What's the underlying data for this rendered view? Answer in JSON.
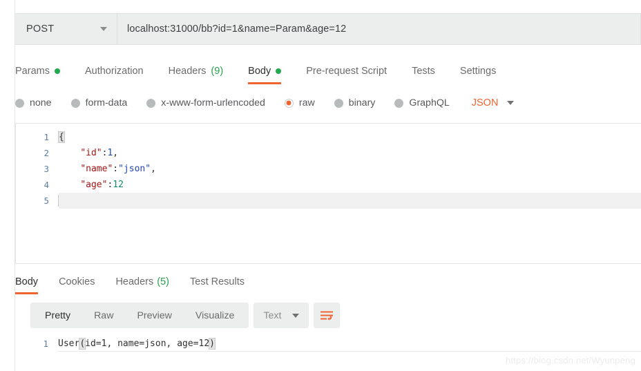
{
  "request": {
    "method": "POST",
    "url": "localhost:31000/bb?id=1&name=Param&age=12",
    "tabs": [
      {
        "label": "Params",
        "indicator": "dot",
        "active": false
      },
      {
        "label": "Authorization",
        "indicator": "none",
        "active": false
      },
      {
        "label": "Headers",
        "indicator": "count",
        "count": "(9)",
        "active": false
      },
      {
        "label": "Body",
        "indicator": "dot",
        "active": true
      },
      {
        "label": "Pre-request Script",
        "indicator": "none",
        "active": false
      },
      {
        "label": "Tests",
        "indicator": "none",
        "active": false
      },
      {
        "label": "Settings",
        "indicator": "none",
        "active": false
      }
    ],
    "body_types": [
      {
        "label": "none",
        "selected": false
      },
      {
        "label": "form-data",
        "selected": false
      },
      {
        "label": "x-www-form-urlencoded",
        "selected": false
      },
      {
        "label": "raw",
        "selected": true
      },
      {
        "label": "binary",
        "selected": false
      },
      {
        "label": "GraphQL",
        "selected": false
      }
    ],
    "raw_format": "JSON",
    "editor_lines": [
      {
        "no": "1",
        "text": "{"
      },
      {
        "no": "2",
        "text": "    \"id\":1,"
      },
      {
        "no": "3",
        "text": "    \"name\":\"json\","
      },
      {
        "no": "4",
        "text": "    \"age\":12"
      },
      {
        "no": "5",
        "text": "}"
      }
    ]
  },
  "response": {
    "tabs": [
      {
        "label": "Body",
        "count": "",
        "active": true
      },
      {
        "label": "Cookies",
        "count": "",
        "active": false
      },
      {
        "label": "Headers",
        "count": "(5)",
        "active": false
      },
      {
        "label": "Test Results",
        "count": "",
        "active": false
      }
    ],
    "view_modes": [
      {
        "label": "Pretty",
        "active": true
      },
      {
        "label": "Raw",
        "active": false
      },
      {
        "label": "Preview",
        "active": false
      },
      {
        "label": "Visualize",
        "active": false
      }
    ],
    "format": "Text",
    "body_lines": [
      {
        "no": "1",
        "text": "User(id=1, name=json, age=12)"
      }
    ]
  },
  "watermark": "https://blog.csdn.net/Wyunpeng",
  "colors": {
    "accent": "#ef6330",
    "green": "#20a94f",
    "toolbar_bg": "#eceded",
    "json_key": "#a81414",
    "json_string": "#2046b5",
    "json_number": "#118a6e"
  }
}
